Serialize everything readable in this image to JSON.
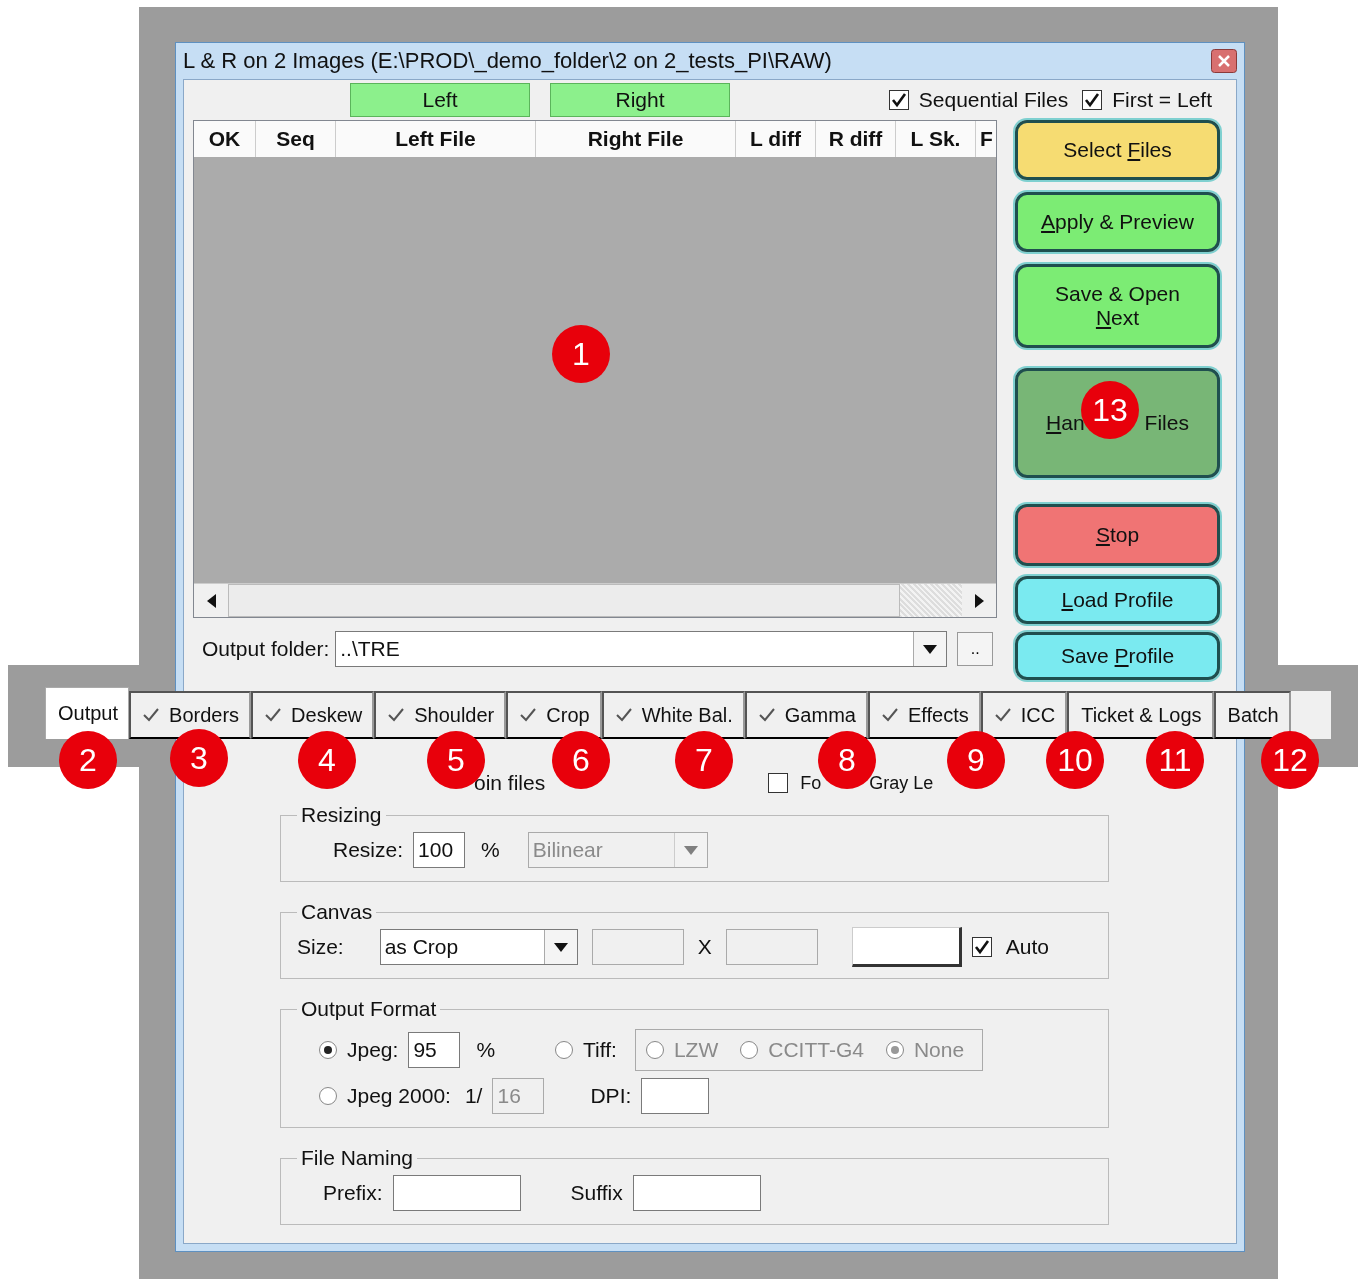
{
  "window": {
    "title": "L & R on 2 Images (E:\\PROD\\_demo_folder\\2 on 2_tests_PI\\RAW)"
  },
  "side_headers": [
    {
      "label": "Left"
    },
    {
      "label": "Right"
    }
  ],
  "options": [
    {
      "label": "Sequential Files",
      "checked": true
    },
    {
      "label": "First = Left",
      "checked": true
    }
  ],
  "table": {
    "columns": [
      "OK",
      "Seq",
      "Left File",
      "Right File",
      "L diff",
      "R diff",
      "L Sk.",
      "F"
    ]
  },
  "actions": [
    {
      "before": "Select ",
      "key": "F",
      "after": "iles",
      "color": "#f6dc72"
    },
    {
      "key": "A",
      "after": "pply & Preview",
      "color": "#7cec74"
    },
    {
      "before": "Save & Open ",
      "key": "N",
      "after": "ext",
      "color": "#7cec74"
    },
    {
      "key": "H",
      "after": "an",
      "tail": "Files",
      "color": "#78b676"
    },
    {
      "key": "S",
      "after": "top",
      "color": "#f07474"
    },
    {
      "key": "L",
      "after": "oad Profile",
      "color": "#7aeaf0"
    },
    {
      "before": "Save ",
      "key": "P",
      "after": "rofile",
      "color": "#7aeaf0"
    }
  ],
  "output_folder": {
    "label": "Output folder:",
    "value": "..\\TRE",
    "browse": ".."
  },
  "tabs": [
    {
      "label": "Output",
      "selected": true,
      "checked": false
    },
    {
      "label": "Borders",
      "selected": false,
      "checked": true
    },
    {
      "label": "Deskew",
      "selected": false,
      "checked": true
    },
    {
      "label": "Shoulder",
      "selected": false,
      "checked": true
    },
    {
      "label": "Crop",
      "selected": false,
      "checked": true
    },
    {
      "label": "White Bal.",
      "selected": false,
      "checked": true
    },
    {
      "label": "Gamma",
      "selected": false,
      "checked": true
    },
    {
      "label": "Effects",
      "selected": false,
      "checked": true
    },
    {
      "label": "ICC",
      "selected": false,
      "checked": true
    },
    {
      "label": "Ticket & Logs",
      "selected": false,
      "checked": false
    },
    {
      "label": "Batch",
      "selected": false,
      "checked": false
    }
  ],
  "join_files": {
    "label": "oin files"
  },
  "force_gray": {
    "checked": false,
    "label": "Fo",
    "label_rest": "Gray Le"
  },
  "resizing": {
    "title": "Resizing",
    "label": "Resize:",
    "value": "100",
    "unit": "%",
    "method": "Bilinear"
  },
  "canvas": {
    "title": "Canvas",
    "label": "Size:",
    "mode": "as Crop",
    "separator": "X",
    "auto": {
      "label": "Auto",
      "checked": true
    }
  },
  "output_format": {
    "title": "Output Format",
    "jpeg": {
      "label": "Jpeg:",
      "selected": true,
      "quality": "95",
      "unit": "%"
    },
    "tiff": {
      "label": "Tiff:",
      "selected": false,
      "compression": [
        {
          "label": "LZW",
          "selected": false
        },
        {
          "label": "CCITT-G4",
          "selected": false
        },
        {
          "label": "None",
          "selected": true
        }
      ]
    },
    "jpeg2000": {
      "label": "Jpeg 2000:",
      "selected": false,
      "prefix": "1/",
      "value": "16"
    },
    "dpi": {
      "label": "DPI:"
    }
  },
  "file_naming": {
    "title": "File Naming",
    "prefix_label": "Prefix:",
    "suffix_label": "Suffix"
  },
  "callouts": [
    "1",
    "2",
    "3",
    "4",
    "5",
    "6",
    "7",
    "8",
    "9",
    "10",
    "11",
    "12",
    "13"
  ]
}
